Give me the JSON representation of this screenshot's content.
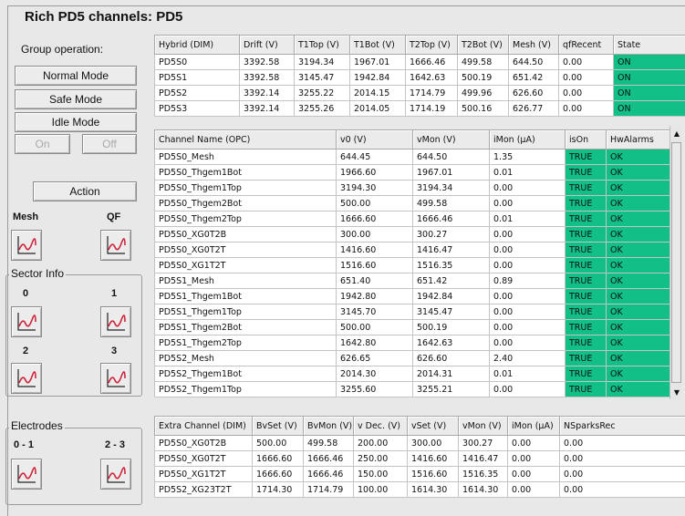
{
  "window": {
    "title": "Rich PD5 channels: PD5"
  },
  "left_panel": {
    "group_label": "Group operation:",
    "buttons": {
      "normal": "Normal Mode",
      "safe": "Safe Mode",
      "idle": "Idle Mode",
      "on": "On",
      "off": "Off",
      "action": "Action"
    },
    "mesh_label": "Mesh",
    "qf_label": "QF",
    "sector_info": {
      "title": "Sector Info",
      "labels": [
        "0",
        "1",
        "2",
        "3"
      ]
    },
    "electrodes": {
      "title": "Electrodes",
      "labels": [
        "0 - 1",
        "2 - 3"
      ]
    }
  },
  "hybrid_table": {
    "headers": [
      "Hybrid (DIM)",
      "Drift (V)",
      "T1Top (V)",
      "T1Bot (V)",
      "T2Top (V)",
      "T2Bot (V)",
      "Mesh (V)",
      "qfRecent",
      "State"
    ],
    "rows": [
      [
        "PD5S0",
        "3392.58",
        "3194.34",
        "1967.01",
        "1666.46",
        "499.58",
        "644.50",
        "0.00",
        "ON"
      ],
      [
        "PD5S1",
        "3392.58",
        "3145.47",
        "1942.84",
        "1642.63",
        "500.19",
        "651.42",
        "0.00",
        "ON"
      ],
      [
        "PD5S2",
        "3392.14",
        "3255.22",
        "2014.15",
        "1714.79",
        "499.96",
        "626.60",
        "0.00",
        "ON"
      ],
      [
        "PD5S3",
        "3392.14",
        "3255.26",
        "2014.05",
        "1714.19",
        "500.16",
        "626.77",
        "0.00",
        "ON"
      ]
    ]
  },
  "channel_table": {
    "headers": [
      "Channel Name (OPC)",
      "v0 (V)",
      "vMon (V)",
      "iMon (µA)",
      "isOn",
      "HwAlarms"
    ],
    "rows": [
      [
        "PD5S0_Mesh",
        "644.45",
        "644.50",
        "1.35",
        "TRUE",
        "OK"
      ],
      [
        "PD5S0_Thgem1Bot",
        "1966.60",
        "1967.01",
        "0.01",
        "TRUE",
        "OK"
      ],
      [
        "PD5S0_Thgem1Top",
        "3194.30",
        "3194.34",
        "0.00",
        "TRUE",
        "OK"
      ],
      [
        "PD5S0_Thgem2Bot",
        "500.00",
        "499.58",
        "0.00",
        "TRUE",
        "OK"
      ],
      [
        "PD5S0_Thgem2Top",
        "1666.60",
        "1666.46",
        "0.01",
        "TRUE",
        "OK"
      ],
      [
        "PD5S0_XG0T2B",
        "300.00",
        "300.27",
        "0.00",
        "TRUE",
        "OK"
      ],
      [
        "PD5S0_XG0T2T",
        "1416.60",
        "1416.47",
        "0.00",
        "TRUE",
        "OK"
      ],
      [
        "PD5S0_XG1T2T",
        "1516.60",
        "1516.35",
        "0.00",
        "TRUE",
        "OK"
      ],
      [
        "PD5S1_Mesh",
        "651.40",
        "651.42",
        "0.89",
        "TRUE",
        "OK"
      ],
      [
        "PD5S1_Thgem1Bot",
        "1942.80",
        "1942.84",
        "0.00",
        "TRUE",
        "OK"
      ],
      [
        "PD5S1_Thgem1Top",
        "3145.70",
        "3145.47",
        "0.00",
        "TRUE",
        "OK"
      ],
      [
        "PD5S1_Thgem2Bot",
        "500.00",
        "500.19",
        "0.00",
        "TRUE",
        "OK"
      ],
      [
        "PD5S1_Thgem2Top",
        "1642.80",
        "1642.63",
        "0.00",
        "TRUE",
        "OK"
      ],
      [
        "PD5S2_Mesh",
        "626.65",
        "626.60",
        "2.40",
        "TRUE",
        "OK"
      ],
      [
        "PD5S2_Thgem1Bot",
        "2014.30",
        "2014.31",
        "0.01",
        "TRUE",
        "OK"
      ],
      [
        "PD5S2_Thgem1Top",
        "3255.60",
        "3255.21",
        "0.00",
        "TRUE",
        "OK"
      ]
    ]
  },
  "extra_table": {
    "headers": [
      "Extra Channel (DIM)",
      "BvSet (V)",
      "BvMon (V)",
      "v Dec. (V)",
      "vSet (V)",
      "vMon (V)",
      "iMon (µA)",
      "NSparksRec"
    ],
    "rows": [
      [
        "PD5S0_XG0T2B",
        "500.00",
        "499.58",
        "200.00",
        "300.00",
        "300.27",
        "0.00",
        "0.00"
      ],
      [
        "PD5S0_XG0T2T",
        "1666.60",
        "1666.46",
        "250.00",
        "1416.60",
        "1416.47",
        "0.00",
        "0.00"
      ],
      [
        "PD5S0_XG1T2T",
        "1666.60",
        "1666.46",
        "150.00",
        "1516.60",
        "1516.35",
        "0.00",
        "0.00"
      ],
      [
        "PD5S2_XG23T2T",
        "1714.30",
        "1714.79",
        "100.00",
        "1614.30",
        "1614.30",
        "0.00",
        "0.00"
      ]
    ]
  },
  "colors": {
    "ok_green": "#12bf86",
    "panel_bg": "#e8e8e8"
  }
}
